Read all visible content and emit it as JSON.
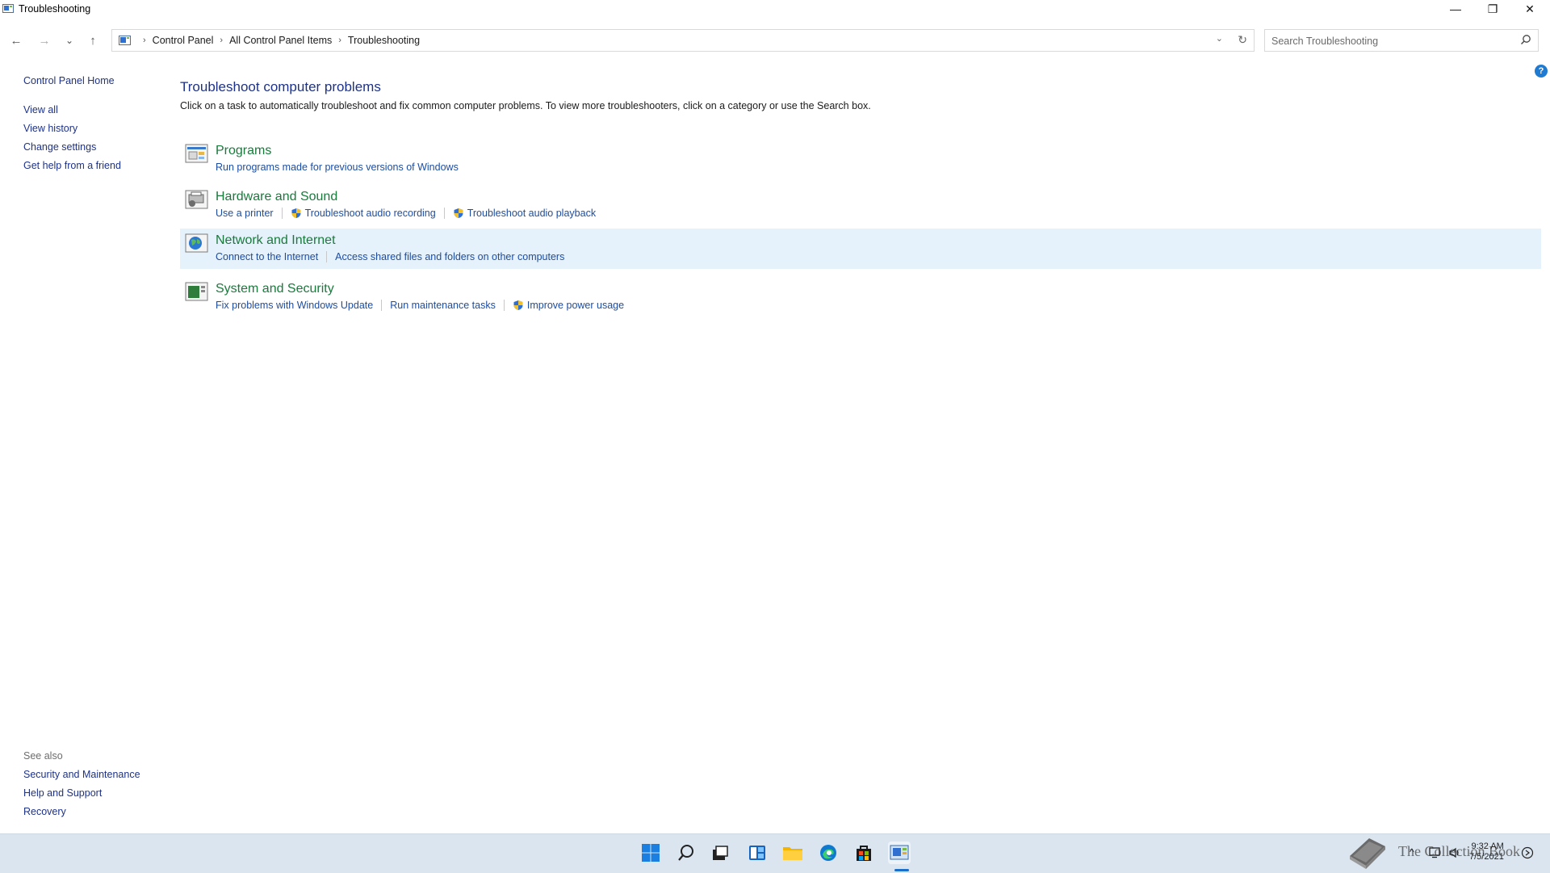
{
  "window": {
    "title": "Troubleshooting",
    "min_label": "—",
    "max_label": "❐",
    "close_label": "✕"
  },
  "nav": {
    "back": "←",
    "forward": "→",
    "recent": "⌄",
    "up": "↑"
  },
  "address": {
    "crumbs": [
      "Control Panel",
      "All Control Panel Items",
      "Troubleshooting"
    ],
    "separator": "›",
    "dropdown": "⌄",
    "refresh": "↻"
  },
  "search": {
    "placeholder": "Search Troubleshooting"
  },
  "help_label": "?",
  "left_pane": {
    "home": "Control Panel Home",
    "links": [
      "View all",
      "View history",
      "Change settings",
      "Get help from a friend"
    ],
    "see_also_title": "See also",
    "see_also": [
      "Security and Maintenance",
      "Help and Support",
      "Recovery"
    ]
  },
  "main": {
    "heading": "Troubleshoot computer problems",
    "description": "Click on a task to automatically troubleshoot and fix common computer problems. To view more troubleshooters, click on a category or use the Search box.",
    "categories": [
      {
        "title": "Programs",
        "tasks": [
          "Run programs made for previous versions of Windows"
        ]
      },
      {
        "title": "Hardware and Sound",
        "tasks": [
          "Use a printer",
          "Troubleshoot audio recording",
          "Troubleshoot audio playback"
        ]
      },
      {
        "title": "Network and Internet",
        "tasks": [
          "Connect to the Internet",
          "Access shared files and folders on other computers"
        ]
      },
      {
        "title": "System and Security",
        "tasks": [
          "Fix problems with Windows Update",
          "Run maintenance tasks",
          "Improve power usage"
        ]
      }
    ]
  },
  "taskbar": {
    "clock_time": "9:32 AM",
    "clock_date": "7/5/2021",
    "watermark": "The Collection Book",
    "tray_chevron": "^"
  },
  "colors": {
    "link": "#1e4da0",
    "category_title": "#1a7a3c",
    "heading": "#1e3287",
    "highlight": "#e5f1fb",
    "taskbar": "#dae5f0"
  }
}
